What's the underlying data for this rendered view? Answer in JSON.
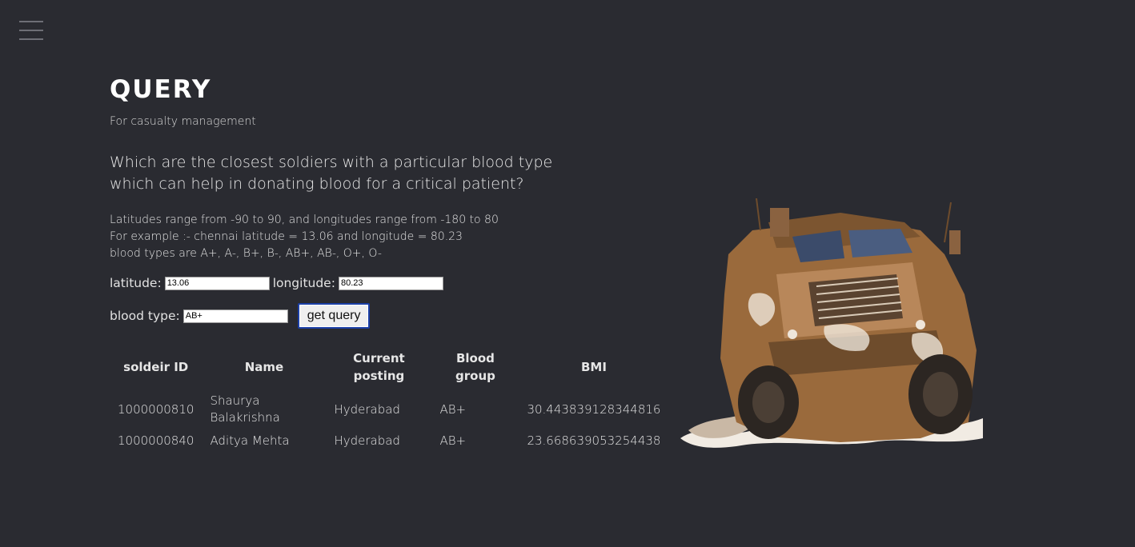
{
  "page": {
    "title": "QUERY",
    "subtitle": "For casualty management",
    "question": "Which are the closest soldiers with a particular blood type which can help in donating blood for a critical patient?",
    "info_lines": [
      "Latitudes range from -90 to 90, and longitudes range from -180 to 80",
      "For example :- chennai latitude = 13.06 and longitude = 80.23",
      "blood types are A+, A-, B+, B-, AB+, AB-, O+, O-"
    ]
  },
  "form": {
    "latitude_label": "latitude:",
    "latitude_value": "13.06",
    "longitude_label": "longitude:",
    "longitude_value": "80.23",
    "blood_label": "blood type:",
    "blood_value": "AB+",
    "submit_label": "get query"
  },
  "table": {
    "headers": [
      "soldeir ID",
      "Name",
      "Current posting",
      "Blood group",
      "BMI"
    ],
    "rows": [
      {
        "id": "1000000810",
        "name": "Shaurya Balakrishna",
        "posting": "Hyderabad",
        "blood": "AB+",
        "bmi": "30.443839128344816"
      },
      {
        "id": "1000000840",
        "name": "Aditya Mehta",
        "posting": "Hyderabad",
        "blood": "AB+",
        "bmi": "23.668639053254438"
      }
    ]
  },
  "icons": {
    "menu": "hamburger-menu-icon",
    "vehicle_image": "armored-truck-image"
  }
}
